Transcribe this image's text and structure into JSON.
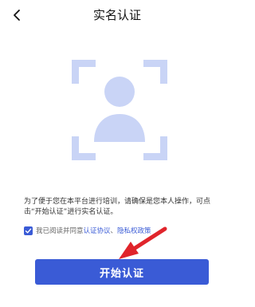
{
  "header": {
    "title": "实名认证",
    "back_icon": "back-chevron-icon"
  },
  "illustration": {
    "icon": "face-scan-icon",
    "color": "#c9d4f6"
  },
  "notice": {
    "text": "为了便于您在本平台进行培训，请确保是您本人操作，可点击“开始认证”进行实名认证。"
  },
  "agreement": {
    "checked": true,
    "prefix": "我已阅读并同意",
    "link_1": "认证协议",
    "separator": "、",
    "link_2": "隐私权政策"
  },
  "start_button": {
    "label": "开始认证"
  },
  "annotation": {
    "icon": "red-arrow-icon",
    "color": "#e0242b"
  },
  "colors": {
    "accent": "#3a5bd6",
    "illustration": "#c9d4f6",
    "annotation": "#e0242b"
  }
}
